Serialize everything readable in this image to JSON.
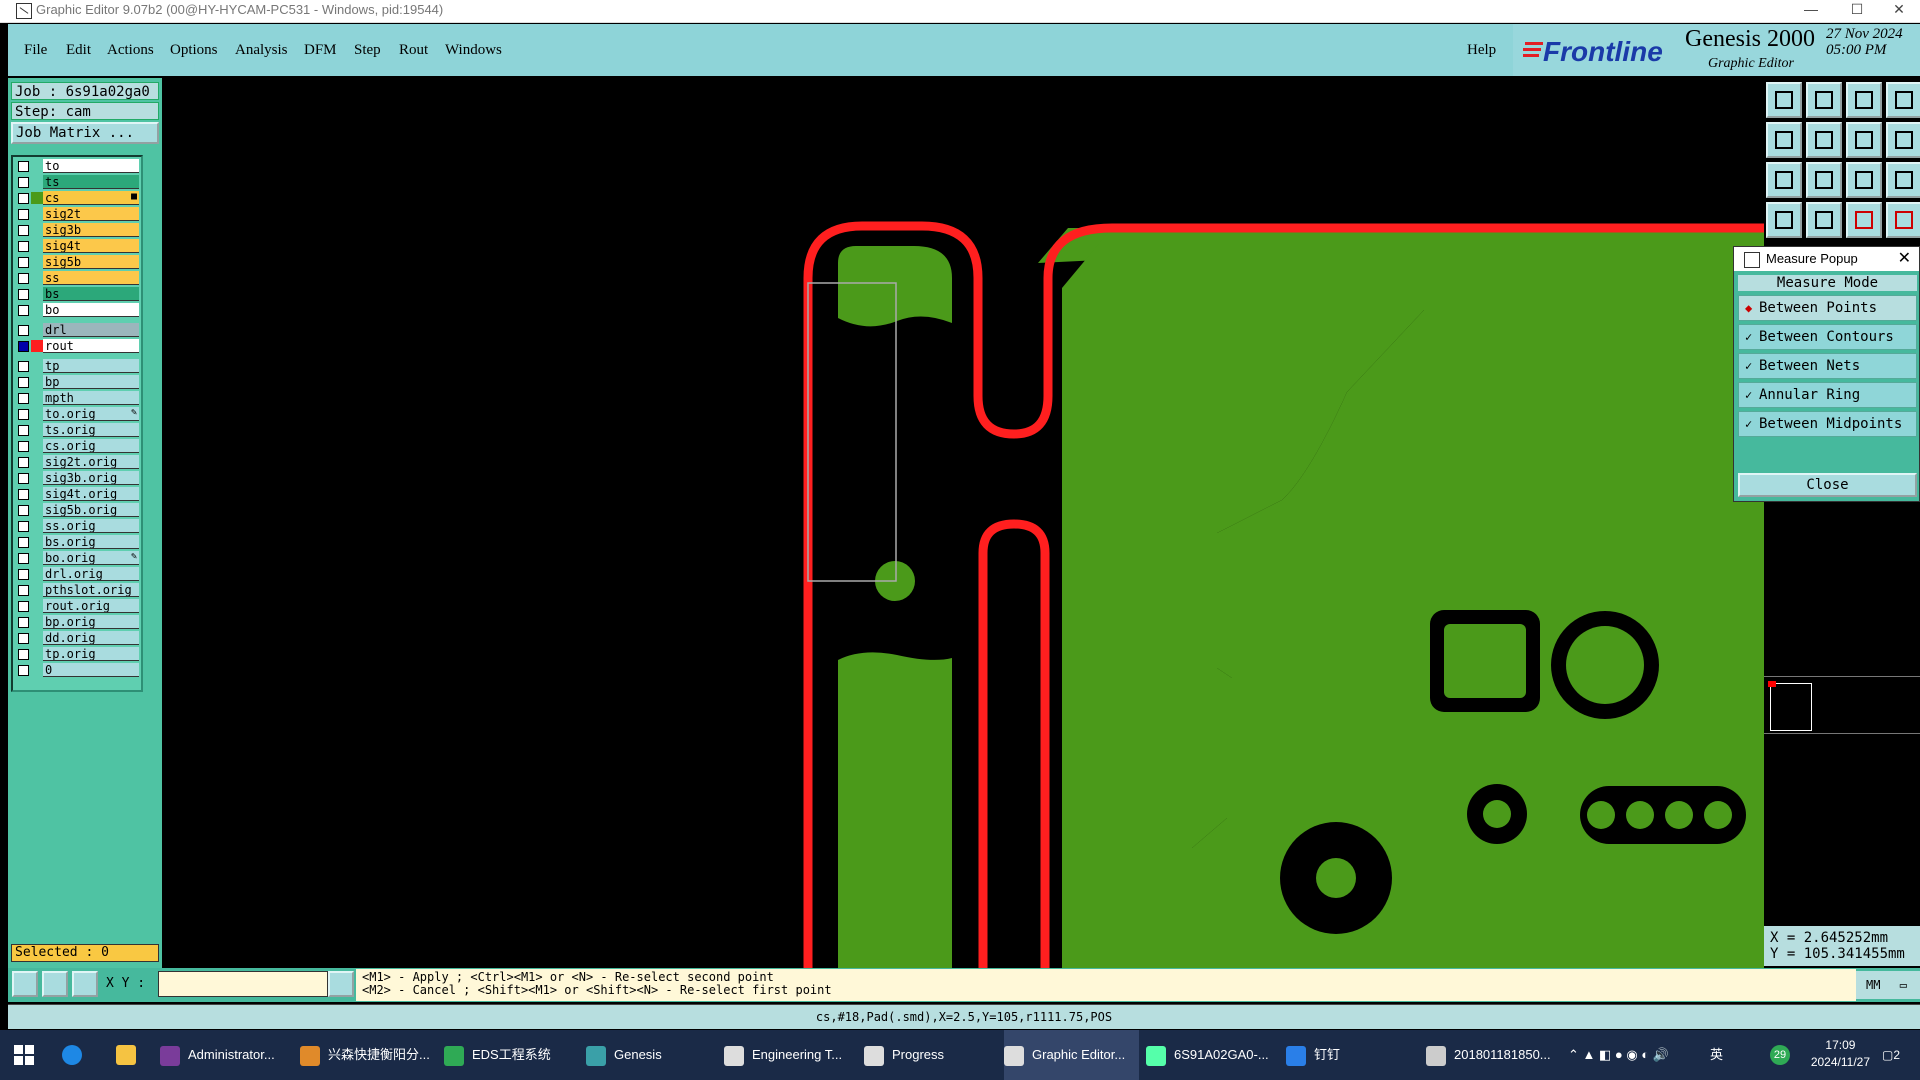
{
  "window": {
    "title": "Graphic Editor 9.07b2 (00@HY-HYCAM-PC531 - Windows, pid:19544)",
    "min": "—",
    "max": "☐",
    "close": "✕"
  },
  "menu": {
    "items": [
      "File",
      "Edit",
      "Actions",
      "Options",
      "Analysis",
      "DFM",
      "Step",
      "Rout",
      "Windows"
    ],
    "help": "Help"
  },
  "brand": {
    "logo": "Frontline",
    "product": "Genesis 2000",
    "subtitle": "Graphic Editor",
    "date": "27 Nov 2024",
    "time": "05:00 PM"
  },
  "job": {
    "label": "Job : 6s91a02ga0",
    "step": "Step: cam",
    "matrix_button": "Job Matrix ..."
  },
  "colors": {
    "ts": "#2ca87a",
    "cs": "#4b9a1a",
    "sig": "#fcc84a",
    "ss": "#f9c842",
    "bs": "#2ca87a",
    "bo": "#ffffff",
    "drl": "#9bb6bc",
    "rout": "#ffffff",
    "other": "#a9dcdf",
    "board": "#4b9a1a",
    "outline": "#ff1f1f"
  },
  "layers": [
    {
      "name": "to",
      "color": "#ffffff"
    },
    {
      "name": "ts",
      "color": "#2ca87a"
    },
    {
      "name": "cs",
      "color": "#f9c842",
      "swatch": "#4b9a1a",
      "edit": "■"
    },
    {
      "name": "sig2t",
      "color": "#fcc84a"
    },
    {
      "name": "sig3b",
      "color": "#fcc84a"
    },
    {
      "name": "sig4t",
      "color": "#fcc84a"
    },
    {
      "name": "sig5b",
      "color": "#fcc84a"
    },
    {
      "name": "ss",
      "color": "#fcc84a"
    },
    {
      "name": "bs",
      "color": "#2ca87a"
    },
    {
      "name": "bo",
      "color": "#ffffff"
    },
    {
      "name": "drl",
      "color": "#9bb6bc",
      "gap": true
    },
    {
      "name": "rout",
      "color": "#ffffff",
      "checked": true,
      "swatch": "#ff1f1f"
    },
    {
      "name": "tp",
      "color": "#a9dcdf",
      "gap": true
    },
    {
      "name": "bp",
      "color": "#a9dcdf"
    },
    {
      "name": "mpth",
      "color": "#a9dcdf"
    },
    {
      "name": "to.orig",
      "color": "#a9dcdf",
      "edit": "✎"
    },
    {
      "name": "ts.orig",
      "color": "#a9dcdf"
    },
    {
      "name": "cs.orig",
      "color": "#a9dcdf"
    },
    {
      "name": "sig2t.orig",
      "color": "#a9dcdf"
    },
    {
      "name": "sig3b.orig",
      "color": "#a9dcdf"
    },
    {
      "name": "sig4t.orig",
      "color": "#a9dcdf"
    },
    {
      "name": "sig5b.orig",
      "color": "#a9dcdf"
    },
    {
      "name": "ss.orig",
      "color": "#a9dcdf"
    },
    {
      "name": "bs.orig",
      "color": "#a9dcdf"
    },
    {
      "name": "bo.orig",
      "color": "#a9dcdf",
      "edit": "✎"
    },
    {
      "name": "drl.orig",
      "color": "#a9dcdf"
    },
    {
      "name": "pthslot.orig",
      "color": "#a9dcdf"
    },
    {
      "name": "rout.orig",
      "color": "#a9dcdf"
    },
    {
      "name": "bp.orig",
      "color": "#a9dcdf"
    },
    {
      "name": "dd.orig",
      "color": "#a9dcdf"
    },
    {
      "name": "tp.orig",
      "color": "#a9dcdf"
    },
    {
      "name": "0",
      "color": "#a9dcdf"
    }
  ],
  "selected": "Selected : 0",
  "measure": {
    "title": "Measure Popup",
    "header": "Measure Mode",
    "options": [
      {
        "label": "Between Points",
        "mark": "◆",
        "active": true
      },
      {
        "label": "Between Contours",
        "mark": "✓"
      },
      {
        "label": "Between Nets",
        "mark": "✓"
      },
      {
        "label": "Annular Ring",
        "mark": "✓"
      },
      {
        "label": "Between Midpoints",
        "mark": "✓"
      }
    ],
    "close": "Close",
    "close_x": "✕"
  },
  "coords": {
    "x": "X = 2.645252mm",
    "y": "Y = 105.341455mm"
  },
  "bottom": {
    "xy_label": "X Y :",
    "xy_value": "",
    "hint_line1": "<M1> - Apply  ; <Ctrl><M1> or <N> - Re-select second point",
    "hint_line2": "<M2> - Cancel ; <Shift><M1> or <Shift><N> - Re-select first point",
    "units": "MM",
    "units_glyph": "▭"
  },
  "status": "cs,#18,Pad(.smd),X=2.5,Y=105,r1111.75,POS",
  "taskbar": {
    "items": [
      {
        "label": "Administrator...",
        "color": "#7a3c9a"
      },
      {
        "label": "兴森快捷衡阳分...",
        "color": "#e08a2a"
      },
      {
        "label": "EDS工程系统",
        "color": "#2faa55"
      },
      {
        "label": "Genesis",
        "color": "#3aa0a8"
      },
      {
        "label": "Engineering T...",
        "color": "#ddd"
      },
      {
        "label": "Progress",
        "color": "#ddd"
      },
      {
        "label": "Graphic Editor...",
        "color": "#ddd"
      },
      {
        "label": "6S91A02GA0-...",
        "color": "#5fa"
      },
      {
        "label": "钉钉",
        "color": "#2a7fe8"
      },
      {
        "label": "201801181850...",
        "color": "#ccc"
      }
    ],
    "time": "17:09",
    "date": "2024/11/27",
    "tray_badge": "29",
    "ime": "英",
    "notif": "2"
  }
}
